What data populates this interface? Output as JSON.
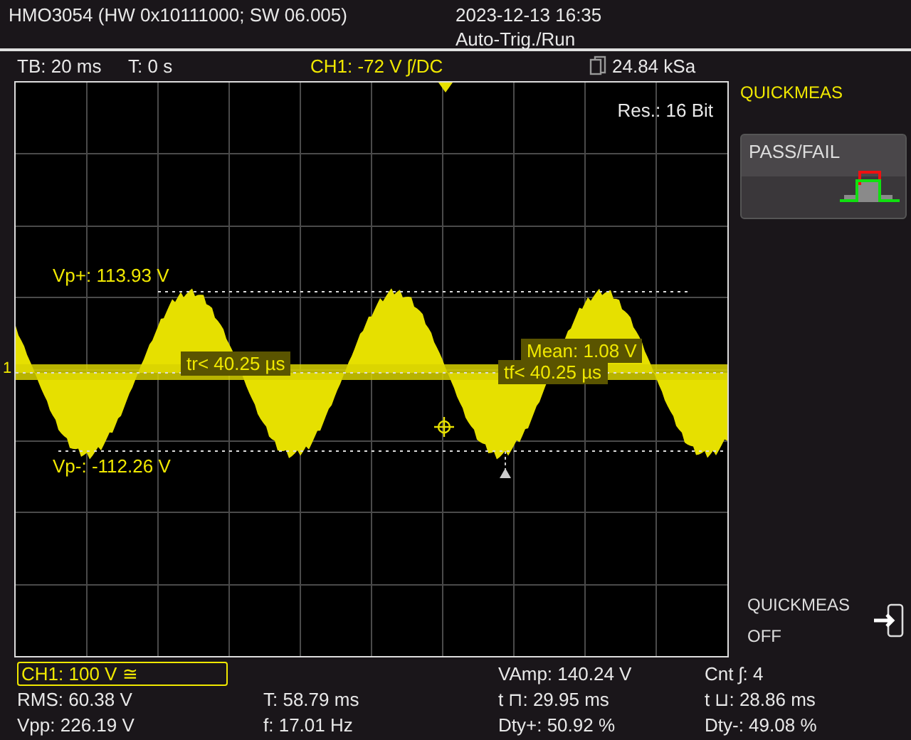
{
  "header": {
    "model": "HMO3054 (HW 0x10111000; SW 06.005)",
    "datetime": "2023-12-13 16:35",
    "trigger_mode": "Auto-Trig./Run"
  },
  "toolbar": {
    "timebase": "TB: 20 ms",
    "trigger_time": "T: 0 s",
    "channel": "CH1: -72 V ʃ/DC",
    "sample_rate": "24.84 kSa"
  },
  "display": {
    "resolution": "Res.: 16 Bit",
    "channel_marker": "1",
    "vp_plus": "Vp+: 113.93 V",
    "vp_minus": "Vp-: -112.26 V",
    "rise_time": "tr< 40.25 µs",
    "fall_time": "tf< 40.25 µs",
    "mean": "Mean: 1.08 V"
  },
  "side_menu": {
    "title": "QUICKMEAS",
    "softkeys": [
      {
        "kind": "pass_fail",
        "label": "PASS/FAIL"
      },
      {
        "kind": "exit",
        "label": "QUICKMEAS",
        "value": "OFF"
      }
    ]
  },
  "measurements": {
    "channel": "CH1: 100 V ≅",
    "top_row": [
      "VAmp: 140.24 V",
      "Cnt ʃ: 4"
    ],
    "rows": [
      [
        "RMS: 60.38 V",
        "T: 58.79 ms",
        "t ⊓: 29.95 ms",
        "t ⊔: 28.86 ms"
      ],
      [
        "Vpp: 226.19 V",
        "f: 17.01 Hz",
        "Dty+: 50.92 %",
        "Dty-: 49.08 %"
      ]
    ]
  }
}
